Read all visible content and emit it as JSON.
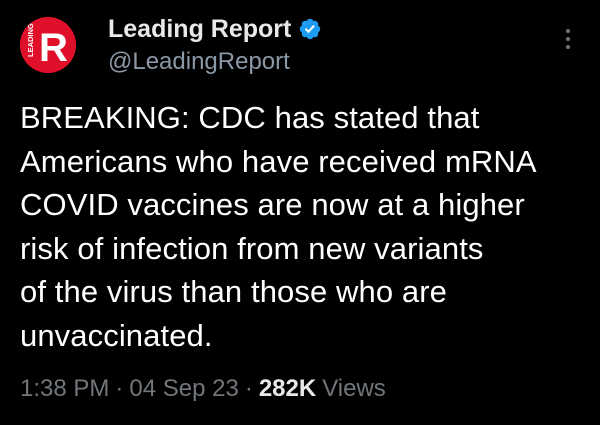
{
  "author": {
    "display_name": "Leading Report",
    "handle": "@LeadingReport",
    "verified": true,
    "avatar": {
      "letter": "R",
      "side_text": "LEADING",
      "background_color": "#e0102a",
      "letter_color": "#ffffff"
    }
  },
  "menu": {
    "icon": "more-vertical-icon"
  },
  "tweet": {
    "text_lines": [
      "BREAKING: CDC has stated that",
      "Americans who have received mRNA",
      "COVID vaccines are now at a higher",
      "risk of infection from new variants",
      "of the virus than those who are",
      "unvaccinated."
    ]
  },
  "meta": {
    "time": "1:38 PM",
    "separator": "·",
    "date": "04 Sep 23",
    "views_count": "282K",
    "views_label": "Views"
  },
  "colors": {
    "background": "#000000",
    "primary_text": "#e7e9ea",
    "secondary_text": "#71767b",
    "verified_badge": "#1d9bf0"
  }
}
